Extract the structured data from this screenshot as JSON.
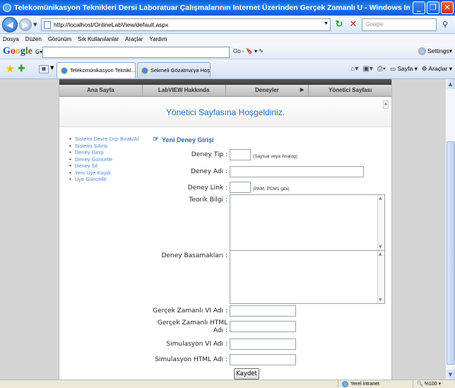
{
  "window": {
    "title": "Telekomünikasyon Teknikleri Dersi Laboratuar Çalışmalarının Internet Üzerinden Gerçek Zamanlı U - Windows Internet Explorer",
    "minimize": "_",
    "maximize": "❐",
    "close": "✕"
  },
  "address": {
    "url": "http://localhost/OnlineLabView/default.aspx",
    "search_placeholder": "Google"
  },
  "menu": [
    {
      "label": "Dosya"
    },
    {
      "label": "Düzen"
    },
    {
      "label": "Görünüm"
    },
    {
      "label": "Sık Kullanılanlar"
    },
    {
      "label": "Araçlar"
    },
    {
      "label": "Yardım"
    }
  ],
  "google_toolbar": {
    "tools": "Go ◦ 🔖 ▾   ✎",
    "settings": "Settings▾"
  },
  "tabs": {
    "active": "Telekomünikasyon Teknikl...",
    "inactive": "Sekmeli Gözatma'ya Hoş Geld...",
    "close": "X"
  },
  "command_bar": {
    "page_label": "Sayfa",
    "tools_label": "Araçlar"
  },
  "site": {
    "nav": [
      {
        "label": "Ana Sayfa"
      },
      {
        "label": "LabVIEW Hakkında"
      },
      {
        "label": "Deneyler"
      },
      {
        "label": "Yönetici Sayfası"
      }
    ],
    "welcome": "Yönetici Sayfasına Hoşgeldiniz.",
    "sidebar": [
      {
        "label": "Sistemi Devre Dışı Bırak/Al"
      },
      {
        "label": "Sistemi Sıfırla"
      },
      {
        "label": "Deney Girişi"
      },
      {
        "label": "Deney Güncelle"
      },
      {
        "label": "Deney Sil"
      },
      {
        "label": "Yeni Üye Kaydı"
      },
      {
        "label": "Üye Güncelle"
      }
    ],
    "form": {
      "title": "Yeni Deney Girişi",
      "deney_tip_label": "Deney Tip :",
      "deney_tip_hint": "(Sayısal veya Analog)",
      "deney_adi_label": "Deney Adı :",
      "deney_link_label": "Deney Link :",
      "deney_link_hint": "(PAM, PCM1 gibi)",
      "teorik_bilgi_label": "Teorik Bilgi :",
      "deney_basamaklari_label": "Deney Basamakları :",
      "gercek_vi_label": "Gerçek Zamanlı VI Adı :",
      "gercek_html_label_1": "Gerçek Zamanlı HTML",
      "gercek_html_label_2": "Adı :",
      "sim_vi_label": "Simulasyon VI Adı :",
      "sim_html_label": "Simulasyon HTML Adı :",
      "save": "Kaydet"
    }
  },
  "status": {
    "zone": "Yerel intranet",
    "zoom": "%100"
  }
}
